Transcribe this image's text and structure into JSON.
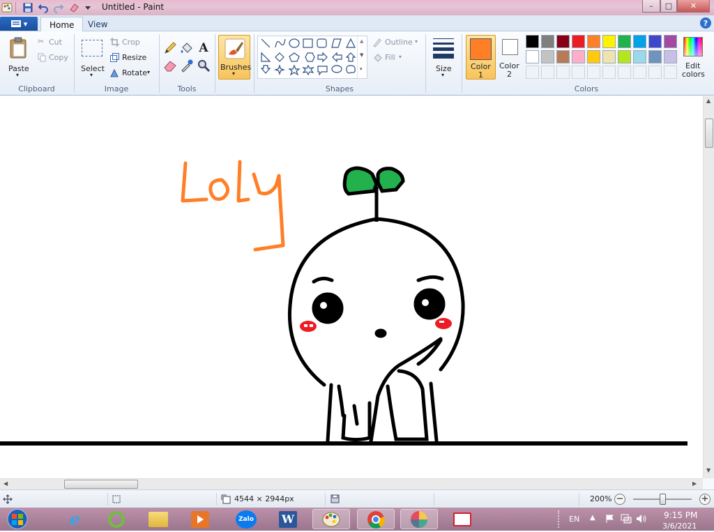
{
  "window": {
    "title": "Untitled - Paint",
    "minimize_glyph": "–",
    "maximize_glyph": "□",
    "close_glyph": "✕"
  },
  "tabs": {
    "file_glyph": "▾",
    "home": "Home",
    "view": "View",
    "help_glyph": "?"
  },
  "clipboard": {
    "paste": "Paste",
    "cut": "Cut",
    "copy": "Copy",
    "label": "Clipboard"
  },
  "image": {
    "select": "Select",
    "crop": "Crop",
    "resize": "Resize",
    "rotate": "Rotate",
    "label": "Image"
  },
  "tools": {
    "label": "Tools",
    "text_glyph": "A"
  },
  "brushes": {
    "label": "Brushes"
  },
  "shapes": {
    "outline": "Outline",
    "fill": "Fill",
    "label": "Shapes"
  },
  "size": {
    "label": "Size"
  },
  "colors": {
    "color1_label_line1": "Color",
    "color1_label_line2": "1",
    "color2_label_line1": "Color",
    "color2_label_line2": "2",
    "color1": "#ff7f27",
    "color2": "#ffffff",
    "edit_colors_line1": "Edit",
    "edit_colors_line2": "colors",
    "group_label": "Colors",
    "palette_row1": [
      "#000000",
      "#7f7f7f",
      "#880015",
      "#ed1c24",
      "#ff7f27",
      "#fff200",
      "#22b14c",
      "#00a2e8",
      "#3f48cc",
      "#a349a4"
    ],
    "palette_row2": [
      "#ffffff",
      "#c3c3c3",
      "#b97a57",
      "#ffaec9",
      "#ffc90e",
      "#efe4b0",
      "#b5e61d",
      "#99d9ea",
      "#7092be",
      "#c8bfe7"
    ]
  },
  "canvas": {
    "handwriting": "Loly"
  },
  "status": {
    "dimensions": "4544 × 2944px",
    "zoom": "200%",
    "zoom_level": 0.5
  },
  "taskbar": {
    "language": "EN",
    "time": "9:15 PM",
    "date": "3/6/2021",
    "zalo_label": "Zalo",
    "word_label": "W"
  }
}
